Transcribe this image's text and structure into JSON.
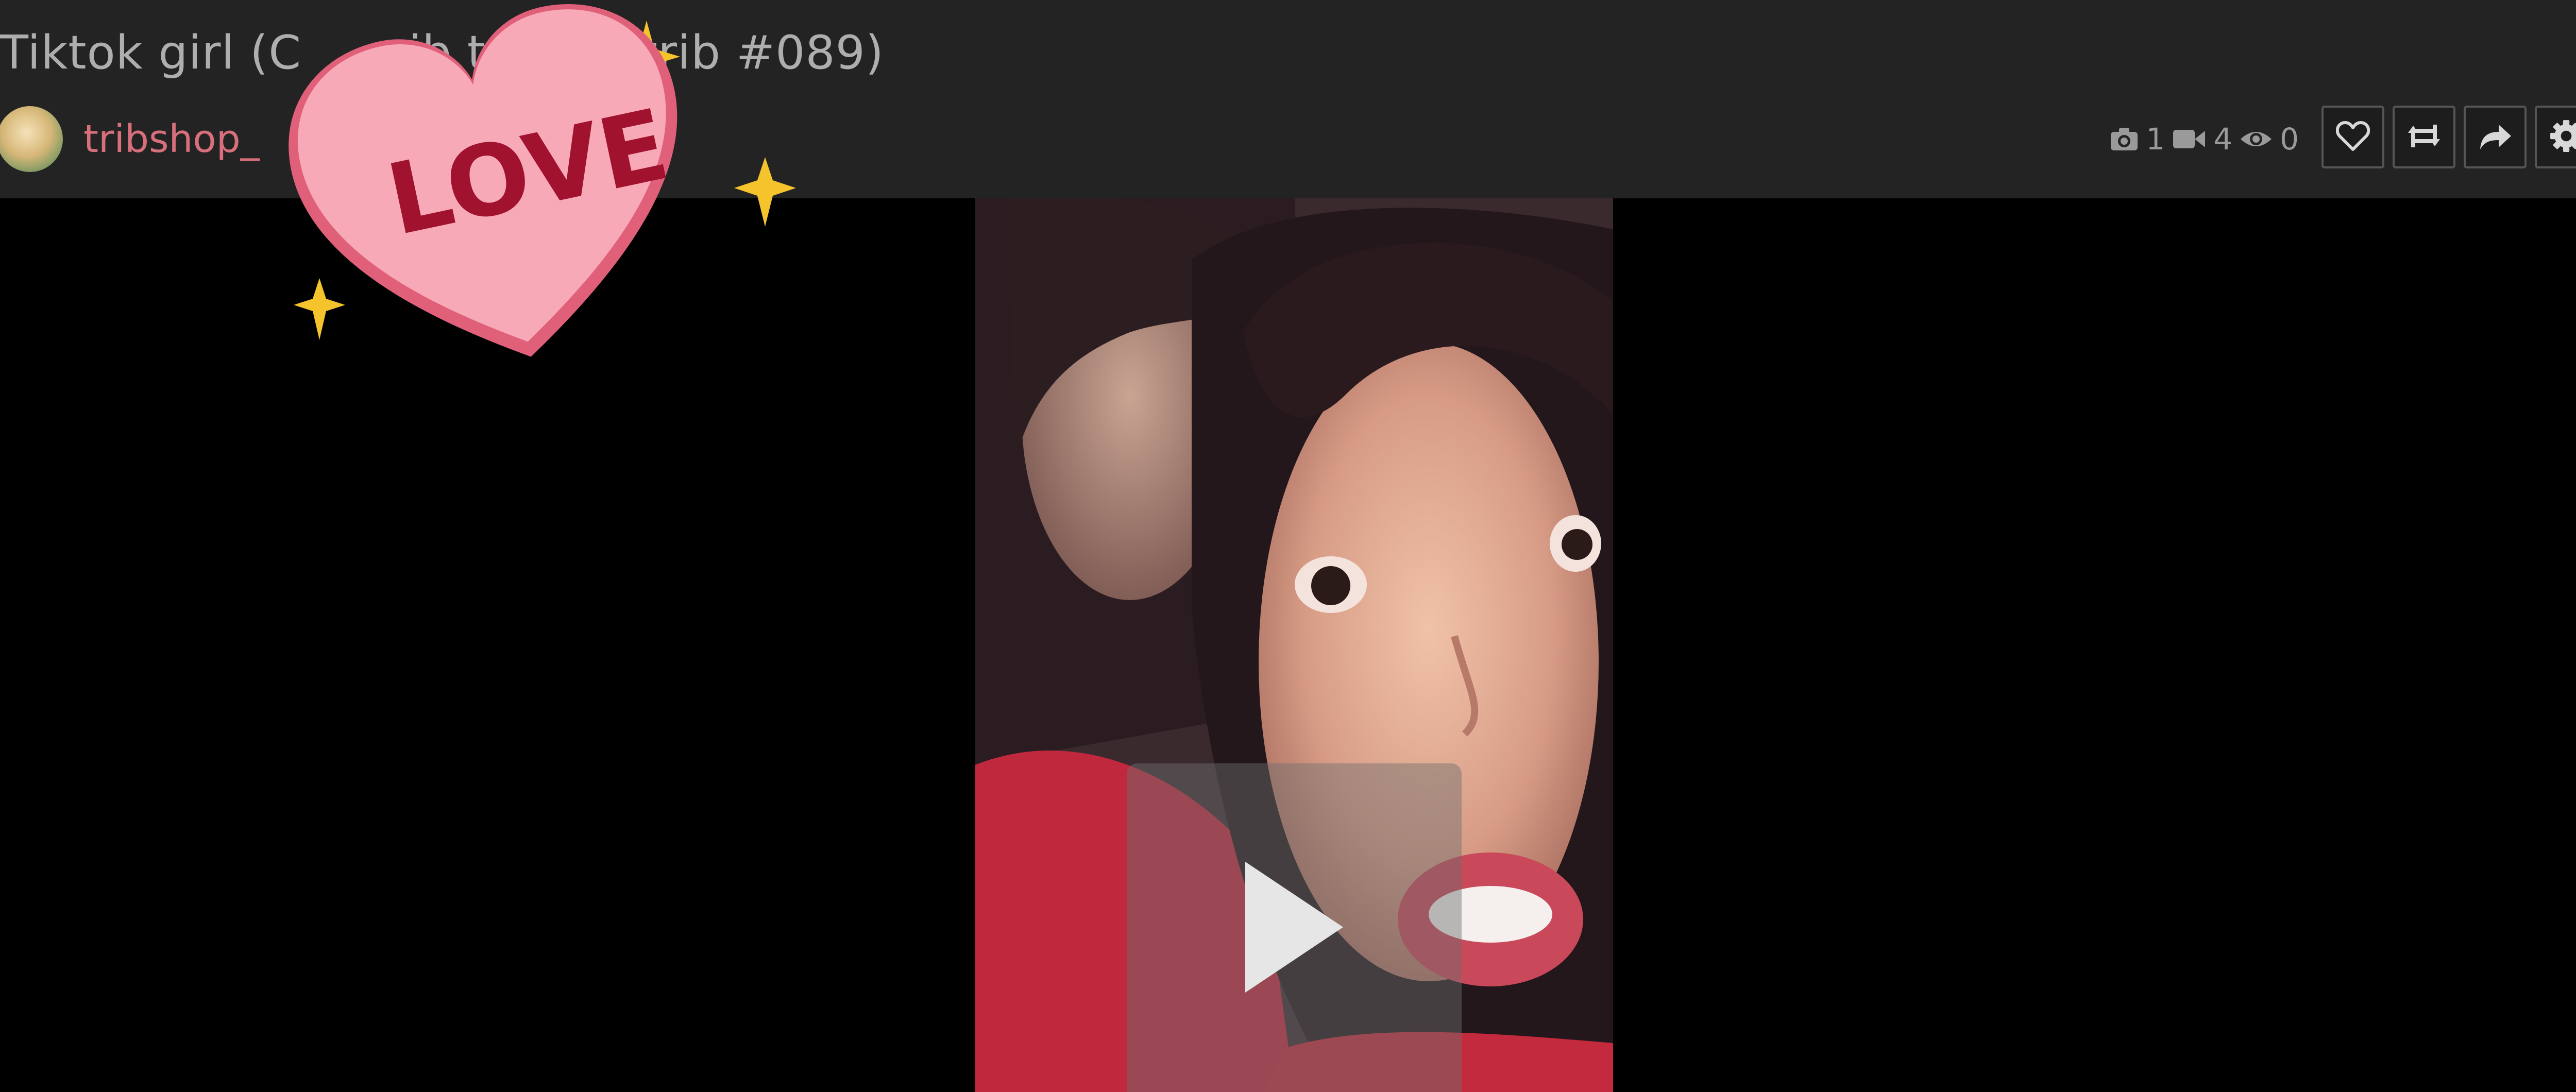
{
  "post": {
    "title": "Tiktok girl (C",
    "title_rest": "rib t",
    "title_end": "erktrib #089)",
    "author": "tribshop_"
  },
  "stats": {
    "photo_count": "1",
    "video_count": "4",
    "view_count": "0",
    "icons": [
      "camera-icon",
      "video-camera-icon",
      "eye-icon"
    ]
  },
  "actions": [
    {
      "name": "like-button",
      "icon": "heart-icon"
    },
    {
      "name": "repost-button",
      "icon": "repost-icon"
    },
    {
      "name": "share-button",
      "icon": "share-icon"
    },
    {
      "name": "settings-button",
      "icon": "gear-icon"
    }
  ],
  "sticker": {
    "text": "LOVE",
    "colors": {
      "heart": "#f7a9b7",
      "heart_shadow": "#e0607a",
      "text": "#a0122e",
      "sparkle": "#f5c32c"
    }
  },
  "colors": {
    "header_bg": "#232323",
    "title": "#aeaeae",
    "author": "#d8707c",
    "page_bg": "#000000"
  }
}
